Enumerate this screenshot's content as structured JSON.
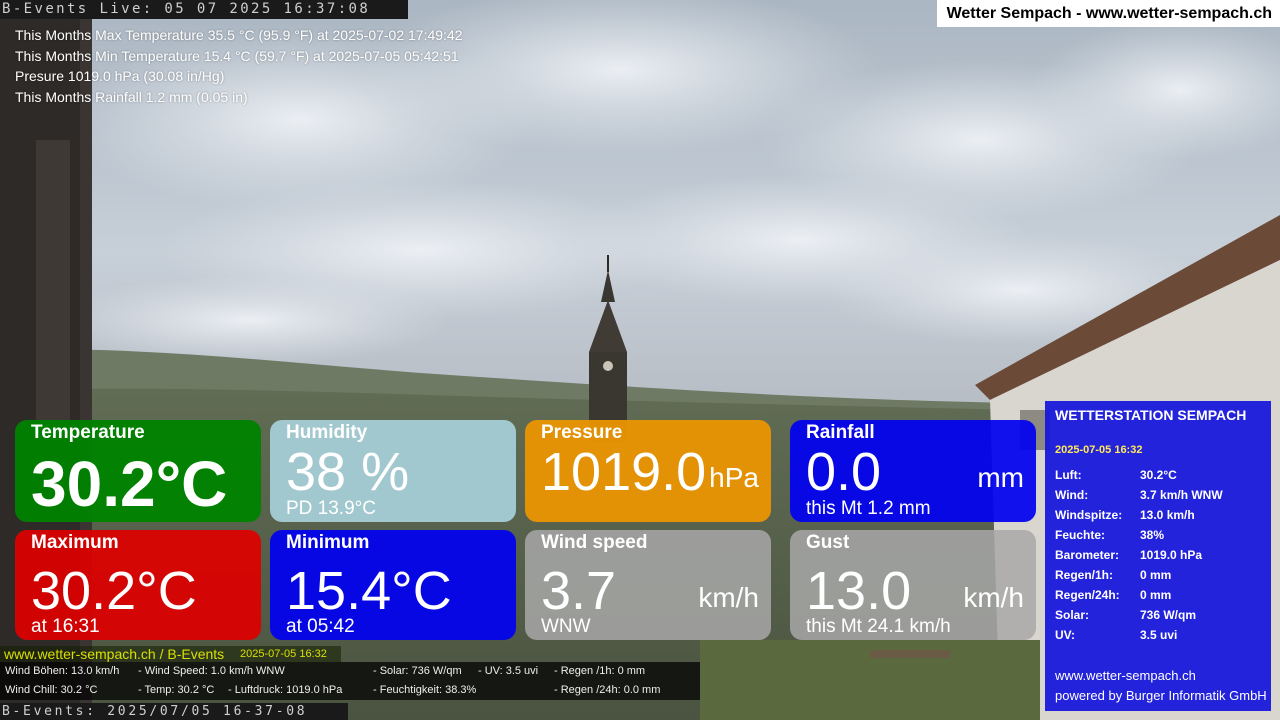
{
  "camera": {
    "overlay_top": "B-Events Live: 05 07 2025 16:37:08",
    "overlay_bottom": "B-Events: 2025/07/05 16-37-08"
  },
  "header": {
    "site_title": "Wetter Sempach - www.wetter-sempach.ch"
  },
  "monthly_stats": [
    "This Months Max Temperature 35.5 °C (95.9 °F) at 2025-07-02 17:49:42",
    "This Months Min Temperature 15.4 °C (59.7 °F) at 2025-07-05 05:42:51",
    "Presure 1019.0 hPa (30.08 in/Hg)",
    "This Months Rainfall 1.2 mm (0.05 in)"
  ],
  "tiles": {
    "temperature": {
      "label": "Temperature",
      "value": "30.2°C"
    },
    "humidity": {
      "label": "Humidity",
      "value": "38 %",
      "sub": "PD 13.9°C"
    },
    "pressure": {
      "label": "Pressure",
      "value": "1019.0",
      "unit": "hPa"
    },
    "rainfall": {
      "label": "Rainfall",
      "value": "0.0",
      "unit": "mm",
      "sub": "this Mt 1.2 mm"
    },
    "maximum": {
      "label": "Maximum",
      "value": "30.2°C",
      "sub": "at 16:31"
    },
    "minimum": {
      "label": "Minimum",
      "value": "15.4°C",
      "sub": "at 05:42"
    },
    "wind_speed": {
      "label": "Wind speed",
      "value": "3.7",
      "unit": "km/h",
      "sub": "WNW"
    },
    "gust": {
      "label": "Gust",
      "value": "13.0",
      "unit": "km/h",
      "sub": "this Mt 24.1 km/h"
    }
  },
  "station_panel": {
    "title": "WETTERSTATION SEMPACH",
    "datetime": "2025-07-05 16:32",
    "rows": [
      {
        "key": "Luft:",
        "value": "30.2°C"
      },
      {
        "key": "Wind:",
        "value": "3.7 km/h  WNW"
      },
      {
        "key": "Windspitze:",
        "value": "13.0 km/h"
      },
      {
        "key": "Feuchte:",
        "value": "38%"
      },
      {
        "key": "Barometer:",
        "value": "1019.0 hPa"
      },
      {
        "key": "Regen/1h:",
        "value": "0 mm"
      },
      {
        "key": "Regen/24h:",
        "value": "0 mm"
      },
      {
        "key": "Solar:",
        "value": "736 W/qm"
      },
      {
        "key": "UV:",
        "value": "3.5 uvi"
      }
    ],
    "url": "www.wetter-sempach.ch",
    "powered_by": "powered by Burger Informatik GmbH"
  },
  "footer": {
    "link_text": "www.wetter-sempach.ch / B-Events",
    "timestamp": "2025-07-05 16:32",
    "line1": {
      "a": "Wind Böhen: 13.0 km/h",
      "b": "- Wind Speed: 1.0 km/h WNW",
      "c": "- Solar: 736 W/qm",
      "d": "- UV: 3.5 uvi",
      "e": "- Regen /1h:   0 mm"
    },
    "line2": {
      "a": "Wind Chill: 30.2 °C",
      "b": "- Temp: 30.2 °C",
      "c": "- Luftdruck: 1019.0 hPa",
      "d": "- Feuchtigkeit: 38.3%",
      "e": "- Regen /24h: 0.0 mm"
    }
  },
  "colors": {
    "temperature": "#008200",
    "humidity": "#a8d0da",
    "pressure": "#ee9600",
    "rainfall": "#0000f0",
    "maximum": "#de0000",
    "minimum": "#0000f0",
    "wind": "#a8a8a8",
    "station_panel": "#1414dc",
    "date_accent": "#ffeb5a"
  }
}
